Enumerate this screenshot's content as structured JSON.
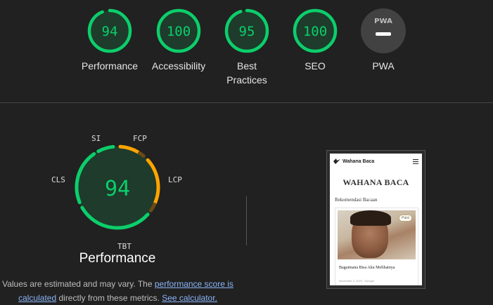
{
  "colors": {
    "good": "#0cce6b",
    "average": "#ffa400",
    "na": "#9e9e9e",
    "link": "#8ab4f8"
  },
  "categories": [
    {
      "score": "94",
      "label": "Performance",
      "fraction": 0.94
    },
    {
      "score": "100",
      "label": "Accessibility",
      "fraction": 1.0
    },
    {
      "score": "95",
      "label": "Best Practices",
      "fraction": 0.95
    },
    {
      "score": "100",
      "label": "SEO",
      "fraction": 1.0
    },
    {
      "score": "PWA",
      "label": "PWA",
      "fraction": null
    }
  ],
  "performance": {
    "score": "94",
    "title": "Performance",
    "metrics": [
      "SI",
      "FCP",
      "LCP",
      "TBT",
      "CLS"
    ]
  },
  "note": {
    "prefix": "Values are estimated and may vary. The ",
    "link1": "performance score is calculated",
    "middle": " directly from these metrics. ",
    "link2": "See calculator."
  },
  "screenshot": {
    "brand": "Wahana Baca",
    "title": "WAHANA BACA",
    "section": "Rekomendasi Bacaan",
    "badge": "Puisi",
    "card_title": "Bagaimana Bisa Aku Melihatnya",
    "meta": "November 2, 2023 · Kompel",
    "menu_icon": "hamburger-icon"
  }
}
